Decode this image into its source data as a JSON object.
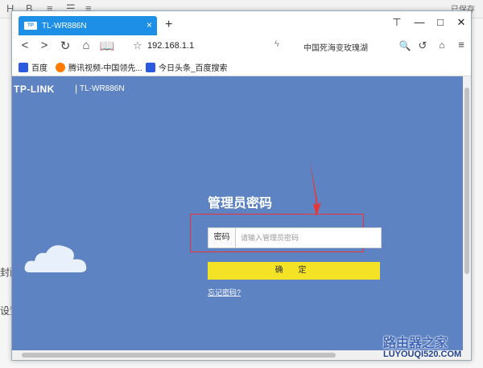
{
  "background_app": {
    "toolbar_glyphs": [
      "H",
      "B",
      "≡",
      "☰",
      "≡"
    ],
    "side_texts": [
      "封面",
      "设置"
    ],
    "right_text": "已保存"
  },
  "browser": {
    "tab_title": "TL-WR886N",
    "tab_logo": "TP",
    "new_tab": "+",
    "url": "192.168.1.1",
    "search_text": "中国死海变玫瑰湖",
    "bookmarks": [
      {
        "label": "百度",
        "color": "#2b5ae0"
      },
      {
        "label": "腾讯视频-中国领先...",
        "color": "#ff7a00"
      },
      {
        "label": "今日头条_百度搜索",
        "color": "#2b5ae0"
      }
    ]
  },
  "page": {
    "brand": "TP-LINK",
    "model": "TL-WR886N",
    "login_title": "管理员密码",
    "password_label": "密码",
    "password_placeholder": "请输入管理员密码",
    "confirm_button": "确 定",
    "forgot_link": "忘记密码?"
  },
  "watermark": {
    "title": "路由器之家",
    "url": "LUYOUQI520.COM"
  },
  "colors": {
    "page_bg": "#5e83c2",
    "tab_bg": "#1e8fe6",
    "button": "#f4e227",
    "highlight": "#e33333"
  },
  "icons": {
    "back": "back-icon",
    "forward": "forward-icon",
    "reload": "reload-icon",
    "home": "home-icon",
    "reader": "reader-icon",
    "star": "star-icon"
  }
}
